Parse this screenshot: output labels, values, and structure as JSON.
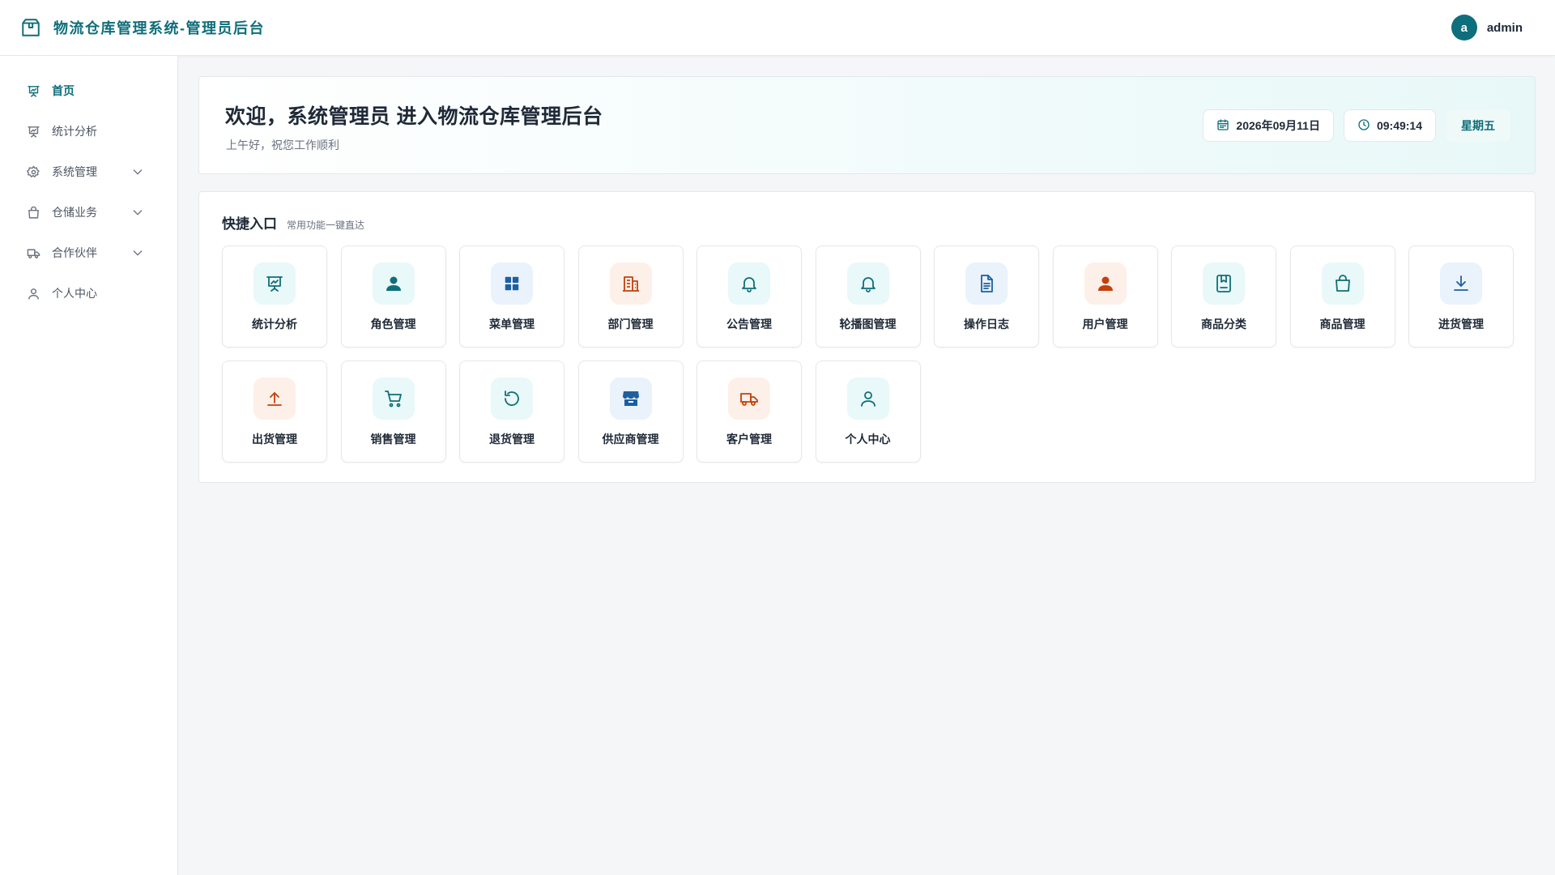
{
  "header": {
    "title": "物流仓库管理系统-管理员后台",
    "brand_icon": "box-icon",
    "user": {
      "avatar_letter": "a",
      "name": "admin"
    }
  },
  "sidebar": {
    "items": [
      {
        "label": "首页",
        "icon": "presentation-icon",
        "active": true,
        "expandable": false
      },
      {
        "label": "统计分析",
        "icon": "presentation-icon",
        "active": false,
        "expandable": false
      },
      {
        "label": "系统管理",
        "icon": "gear-icon",
        "active": false,
        "expandable": true
      },
      {
        "label": "仓储业务",
        "icon": "bag-icon",
        "active": false,
        "expandable": true
      },
      {
        "label": "合作伙伴",
        "icon": "truck-icon",
        "active": false,
        "expandable": true
      },
      {
        "label": "个人中心",
        "icon": "user-icon",
        "active": false,
        "expandable": false
      }
    ]
  },
  "welcome": {
    "title": "欢迎，系统管理员 进入物流仓库管理后台",
    "subtitle": "上午好，祝您工作顺利",
    "date": "2026年09月11日",
    "time": "09:49:14",
    "weekday": "星期五"
  },
  "quick": {
    "title": "快捷入口",
    "subtitle": "常用功能一键直达",
    "tiles": [
      {
        "label": "统计分析",
        "icon": "presentation-icon",
        "tone": "teal"
      },
      {
        "label": "角色管理",
        "icon": "user-solid-icon",
        "tone": "teal"
      },
      {
        "label": "菜单管理",
        "icon": "grid-icon",
        "tone": "blue"
      },
      {
        "label": "部门管理",
        "icon": "building-icon",
        "tone": "orange"
      },
      {
        "label": "公告管理",
        "icon": "bell-icon",
        "tone": "teal"
      },
      {
        "label": "轮播图管理",
        "icon": "bell-icon",
        "tone": "teal"
      },
      {
        "label": "操作日志",
        "icon": "document-icon",
        "tone": "blue"
      },
      {
        "label": "用户管理",
        "icon": "users-icon",
        "tone": "orange"
      },
      {
        "label": "商品分类",
        "icon": "book-icon",
        "tone": "teal"
      },
      {
        "label": "商品管理",
        "icon": "bag-icon",
        "tone": "teal"
      },
      {
        "label": "进货管理",
        "icon": "download-icon",
        "tone": "blue"
      },
      {
        "label": "出货管理",
        "icon": "upload-icon",
        "tone": "orange"
      },
      {
        "label": "销售管理",
        "icon": "cart-icon",
        "tone": "teal"
      },
      {
        "label": "退货管理",
        "icon": "refresh-icon",
        "tone": "teal"
      },
      {
        "label": "供应商管理",
        "icon": "shop-icon",
        "tone": "blue"
      },
      {
        "label": "客户管理",
        "icon": "truck-icon",
        "tone": "orange"
      },
      {
        "label": "个人中心",
        "icon": "user-icon",
        "tone": "teal"
      }
    ]
  },
  "colors": {
    "primary": "#0f6e7a",
    "accent_orange": "#c2410c",
    "accent_blue": "#1e5fa0"
  }
}
